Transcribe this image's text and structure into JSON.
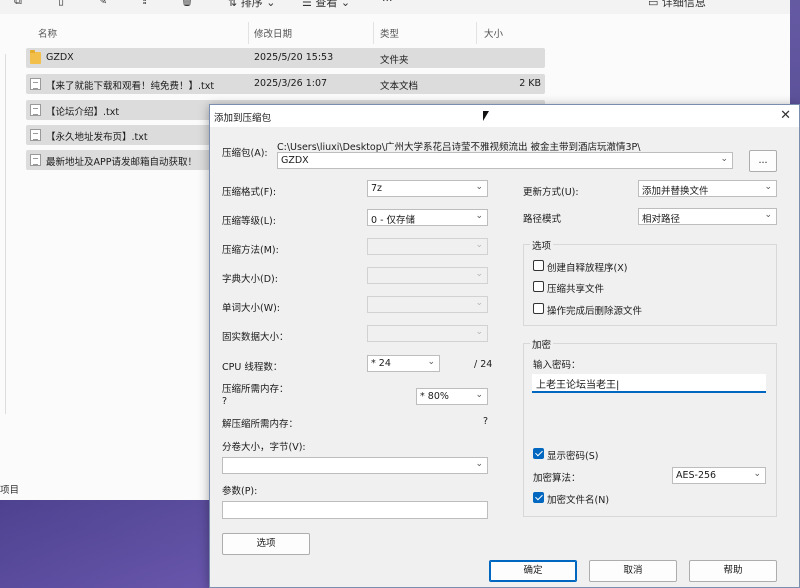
{
  "explorer": {
    "toolbar": {
      "sort_label": "排序",
      "view_label": "查看",
      "more_label": "···",
      "details_label": "详细信息"
    },
    "columns": [
      "名称",
      "修改日期",
      "类型",
      "大小"
    ],
    "files": [
      {
        "name": "GZDX",
        "date": "2025/5/20 15:53",
        "type": "文件夹",
        "size": "",
        "icon": "folder-icon"
      },
      {
        "name": "【来了就能下载和观看！纯免费！】.txt",
        "date": "2025/3/26 1:07",
        "type": "文本文档",
        "size": "2 KB",
        "icon": "text-file-icon"
      },
      {
        "name": "【论坛介绍】.txt",
        "date": "",
        "type": "",
        "size": "",
        "icon": "text-file-icon"
      },
      {
        "name": "【永久地址发布页】.txt",
        "date": "",
        "type": "",
        "size": "",
        "icon": "text-file-icon"
      },
      {
        "name": "最新地址及APP请发邮箱自动获取！",
        "date": "",
        "type": "",
        "size": "",
        "icon": "text-file-icon"
      }
    ],
    "status_text": "项目"
  },
  "dialog": {
    "title": "添加到压缩包",
    "archive_label": "压缩包(A):",
    "archive_path": "C:\\Users\\liuxi\\Desktop\\广州大学系花吕诗莹不雅视频流出 被金主带到酒店玩澈情3P\\",
    "archive_name": "GZDX",
    "browse_label": "...",
    "left": {
      "format_label": "压缩格式(F):",
      "format_value": "7z",
      "level_label": "压缩等级(L):",
      "level_value": "0 - 仅存储",
      "method_label": "压缩方法(M):",
      "dict_label": "字典大小(D):",
      "word_label": "单词大小(W):",
      "solid_label": "固实数据大小：",
      "cpu_label": "CPU 线程数：",
      "cpu_value": "* 24",
      "cpu_total": "/ 24",
      "mem_label": "压缩所需内存：",
      "mem_hint": "?",
      "mem_value": "* 80%",
      "decomp_label": "解压缩所需内存：",
      "decomp_value": "?",
      "split_label": "分卷大小，字节(V):",
      "params_label": "参数(P):",
      "options_button": "选项"
    },
    "right": {
      "update_label": "更新方式(U):",
      "update_value": "添加并替换文件",
      "path_label": "路径模式",
      "path_value": "相对路径",
      "options_group": "选项",
      "opt_sfx": "创建自释放程序(X)",
      "opt_shared": "压缩共享文件",
      "opt_delete": "操作完成后删除源文件",
      "encrypt_group": "加密",
      "password_label": "输入密码：",
      "password_value": "上老王论坛当老王|",
      "show_password": "显示密码(S)",
      "algo_label": "加密算法：",
      "algo_value": "AES-256",
      "encrypt_names": "加密文件名(N)"
    },
    "buttons": {
      "ok": "确定",
      "cancel": "取消",
      "help": "帮助"
    }
  }
}
